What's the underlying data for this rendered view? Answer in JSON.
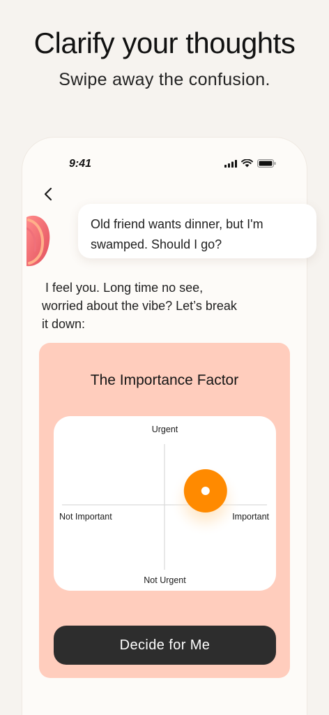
{
  "promo": {
    "headline": "Clarify your thoughts",
    "subline": "Swipe away the confusion."
  },
  "status_bar": {
    "time": "9:41",
    "icons": [
      "signal-icon",
      "wifi-icon",
      "battery-icon"
    ]
  },
  "chat": {
    "back_icon": "chevron-left-icon",
    "user_message": "Old friend wants dinner, but I'm swamped. Should I go?",
    "assistant_reply": " I feel you. Long time no see,\nworried about the vibe? Let’s break\nit down:"
  },
  "matrix_card": {
    "title": "The Importance Factor",
    "axis": {
      "top": "Urgent",
      "bottom": "Not Urgent",
      "left": "Not Important",
      "right": "Important"
    },
    "marker": {
      "importance": 0.4,
      "urgency": 0.23,
      "color": "#ff8a00"
    },
    "colors": {
      "card": "#ffcdbd",
      "panel": "#ffffff"
    }
  },
  "action": {
    "decide_label": "Decide for Me"
  }
}
